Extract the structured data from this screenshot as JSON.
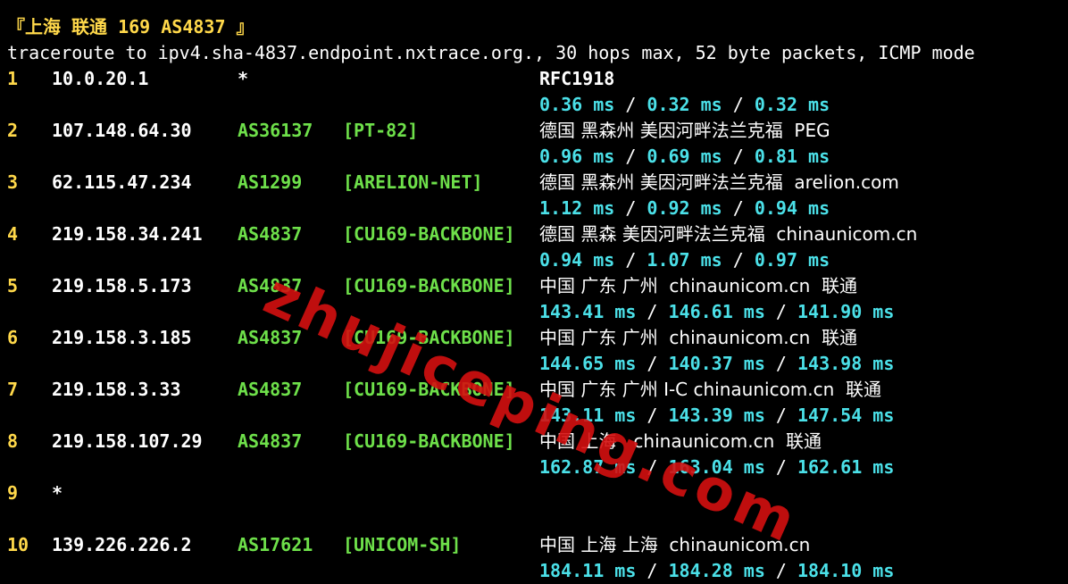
{
  "header": {
    "title": "『上海 联通 169 AS4837 』",
    "command": "traceroute to ipv4.sha-4837.endpoint.nxtrace.org., 30 hops max, 52 byte packets, ICMP mode"
  },
  "hops": [
    {
      "num": "1",
      "ip": "10.0.20.1",
      "asn": "*",
      "net": "",
      "geo": "RFC1918",
      "rtt": [
        "0.36 ms",
        "0.32 ms",
        "0.32 ms"
      ]
    },
    {
      "num": "2",
      "ip": "107.148.64.30",
      "asn": "AS36137",
      "net": "[PT-82]",
      "geo": "德国 黑森州 美因河畔法兰克福  PEG",
      "rtt": [
        "0.96 ms",
        "0.69 ms",
        "0.81 ms"
      ]
    },
    {
      "num": "3",
      "ip": "62.115.47.234",
      "asn": "AS1299",
      "net": "[ARELION-NET]",
      "geo": "德国 黑森州 美因河畔法兰克福  arelion.com",
      "rtt": [
        "1.12 ms",
        "0.92 ms",
        "0.94 ms"
      ]
    },
    {
      "num": "4",
      "ip": "219.158.34.241",
      "asn": "AS4837",
      "net": "[CU169-BACKBONE]",
      "geo": "德国 黑森 美因河畔法兰克福  chinaunicom.cn",
      "rtt": [
        "0.94 ms",
        "1.07 ms",
        "0.97 ms"
      ]
    },
    {
      "num": "5",
      "ip": "219.158.5.173",
      "asn": "AS4837",
      "net": "[CU169-BACKBONE]",
      "geo": "中国 广东 广州  chinaunicom.cn  联通",
      "rtt": [
        "143.41 ms",
        "146.61 ms",
        "141.90 ms"
      ]
    },
    {
      "num": "6",
      "ip": "219.158.3.185",
      "asn": "AS4837",
      "net": "[CU169-BACKBONE]",
      "geo": "中国 广东 广州  chinaunicom.cn  联通",
      "rtt": [
        "144.65 ms",
        "140.37 ms",
        "143.98 ms"
      ]
    },
    {
      "num": "7",
      "ip": "219.158.3.33",
      "asn": "AS4837",
      "net": "[CU169-BACKBONE]",
      "geo": "中国 广东 广州 I-C chinaunicom.cn  联通",
      "rtt": [
        "143.11 ms",
        "143.39 ms",
        "147.54 ms"
      ]
    },
    {
      "num": "8",
      "ip": "219.158.107.29",
      "asn": "AS4837",
      "net": "[CU169-BACKBONE]",
      "geo": "中国 上海   chinaunicom.cn  联通",
      "rtt": [
        "162.87 ms",
        "163.04 ms",
        "162.61 ms"
      ]
    },
    {
      "num": "9",
      "ip": "*",
      "asn": "",
      "net": "",
      "geo": "",
      "rtt": []
    },
    {
      "num": "10",
      "ip": "139.226.226.2",
      "asn": "AS17621",
      "net": "[UNICOM-SH]",
      "geo": "中国 上海 上海  chinaunicom.cn",
      "rtt": [
        "184.11 ms",
        "184.28 ms",
        "184.10 ms"
      ]
    }
  ],
  "watermark": "zhujiceping.com",
  "colors": {
    "background": "#000000",
    "hop_number": "#ffd84a",
    "asn": "#6ee04a",
    "rtt": "#4be0e8",
    "watermark": "#d41010"
  }
}
